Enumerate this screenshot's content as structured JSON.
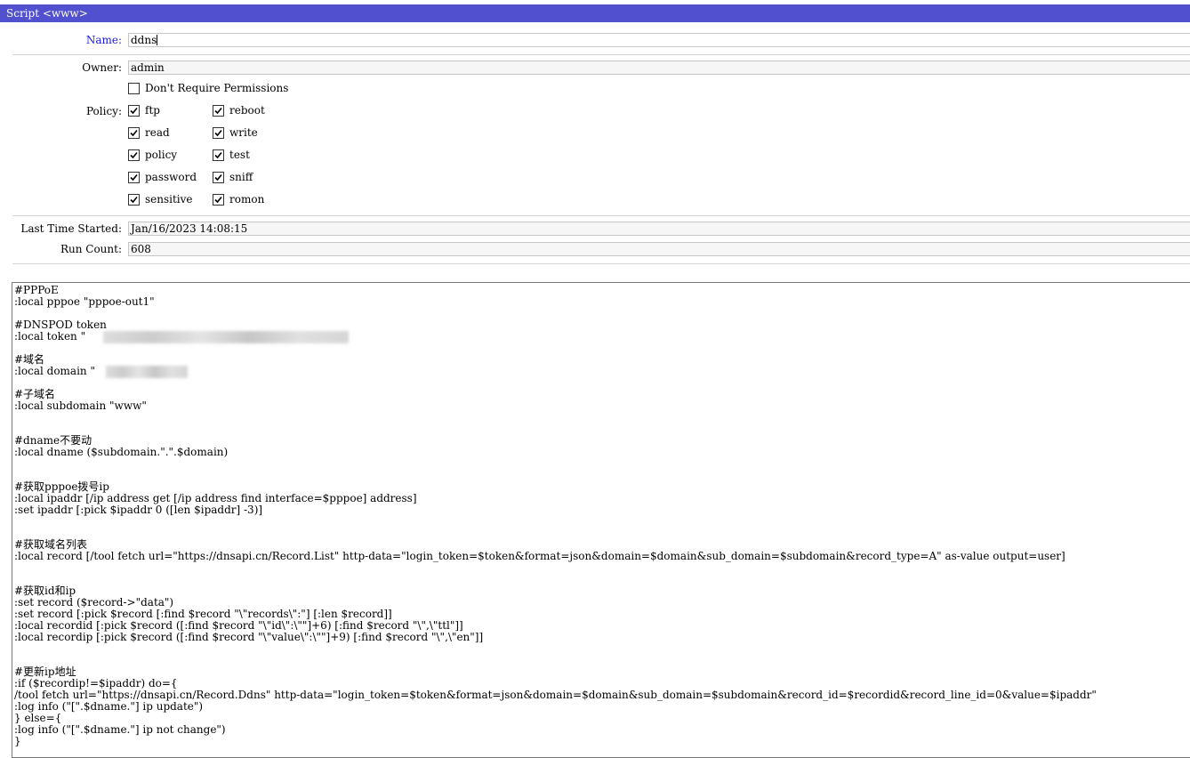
{
  "window": {
    "title": "Script <www>"
  },
  "fields": {
    "name": {
      "label": "Name:",
      "value": "ddns"
    },
    "owner": {
      "label": "Owner:",
      "value": "admin"
    },
    "last_time_started": {
      "label": "Last Time Started:",
      "value": "Jan/16/2023 14:08:15"
    },
    "run_count": {
      "label": "Run Count:",
      "value": "608"
    }
  },
  "dont_require_permissions": {
    "label": "Don't Require Permissions",
    "checked": false
  },
  "policy": {
    "label": "Policy:",
    "col1": [
      {
        "label": "ftp",
        "checked": true
      },
      {
        "label": "read",
        "checked": true
      },
      {
        "label": "policy",
        "checked": true
      },
      {
        "label": "password",
        "checked": true
      },
      {
        "label": "sensitive",
        "checked": true
      }
    ],
    "col2": [
      {
        "label": "reboot",
        "checked": true
      },
      {
        "label": "write",
        "checked": true
      },
      {
        "label": "test",
        "checked": true
      },
      {
        "label": "sniff",
        "checked": true
      },
      {
        "label": "romon",
        "checked": true
      }
    ]
  },
  "source_lines": [
    "#PPPoE",
    ":local pppoe \"pppoe-out1\"",
    "",
    "#DNSPOD token",
    ":local token \"",
    "",
    "#域名",
    ":local domain \"",
    "",
    "#子域名",
    ":local subdomain \"www\"",
    "",
    "",
    "#dname不要动",
    ":local dname ($subdomain.\".\".$domain)",
    "",
    "",
    "#获取pppoe拨号ip",
    ":local ipaddr [/ip address get [/ip address find interface=$pppoe] address]",
    ":set ipaddr [:pick $ipaddr 0 ([len $ipaddr] -3)]",
    "",
    "",
    "#获取域名列表",
    ":local record [/tool fetch url=\"https://dnsapi.cn/Record.List\" http-data=\"login_token=$token&format=json&domain=$domain&sub_domain=$subdomain&record_type=A\" as-value output=user]",
    "",
    "",
    "#获取id和ip",
    ":set record ($record->\"data\")",
    ":set record [:pick $record [:find $record \"\\\"records\\\":\"] [:len $record]]",
    ":local recordid [:pick $record ([:find $record \"\\\"id\\\":\\\"\"]+6) [:find $record \"\\\",\\\"ttl\"]]",
    ":local recordip [:pick $record ([:find $record \"\\\"value\\\":\\\"\"]+9) [:find $record \"\\\",\\\"en\"]]",
    "",
    "",
    "#更新ip地址",
    ":if ($recordip!=$ipaddr) do={",
    "/tool fetch url=\"https://dnsapi.cn/Record.Ddns\" http-data=\"login_token=$token&format=json&domain=$domain&sub_domain=$subdomain&record_id=$recordid&record_line_id=0&value=$ipaddr\"",
    ":log info (\"[\".$dname.\"] ip update\")",
    "} else={",
    ":log info (\"[\".$dname.\"] ip not change\")",
    "}"
  ]
}
